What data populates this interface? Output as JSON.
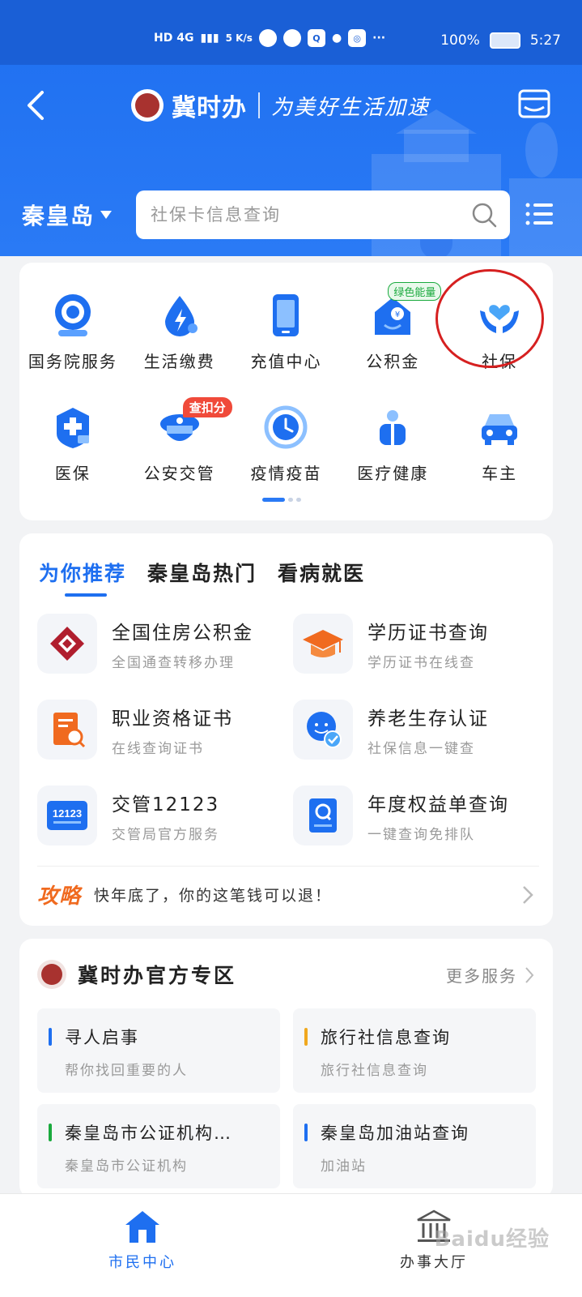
{
  "status_bar": {
    "network": "HD 4G",
    "speed": "5 K/s",
    "more": "···",
    "battery": "100%",
    "time": "5:27"
  },
  "header": {
    "app_name": "冀时办",
    "slogan": "为美好生活加速"
  },
  "search": {
    "city": "秦皇岛",
    "placeholder": "社保卡信息查询"
  },
  "services": {
    "row1": [
      {
        "label": "国务院服务",
        "icon": "state-council-icon"
      },
      {
        "label": "生活缴费",
        "icon": "utility-payment-icon"
      },
      {
        "label": "充值中心",
        "icon": "recharge-icon"
      },
      {
        "label": "公积金",
        "icon": "housing-fund-icon",
        "badge": "绿色能量"
      },
      {
        "label": "社保",
        "icon": "social-security-icon"
      }
    ],
    "row2": [
      {
        "label": "医保",
        "icon": "medical-insurance-icon"
      },
      {
        "label": "公安交管",
        "icon": "traffic-police-icon",
        "badge": "查扣分"
      },
      {
        "label": "疫情疫苗",
        "icon": "vaccine-icon"
      },
      {
        "label": "医疗健康",
        "icon": "health-icon"
      },
      {
        "label": "车主",
        "icon": "car-icon"
      }
    ]
  },
  "recommend": {
    "tabs": [
      "为你推荐",
      "秦皇岛热门",
      "看病就医"
    ],
    "items": [
      {
        "title": "全国住房公积金",
        "sub": "全国通查转移办理"
      },
      {
        "title": "学历证书查询",
        "sub": "学历证书在线查"
      },
      {
        "title": "职业资格证书",
        "sub": "在线查询证书"
      },
      {
        "title": "养老生存认证",
        "sub": "社保信息一键查"
      },
      {
        "title": "交管12123",
        "sub": "交管局官方服务"
      },
      {
        "title": "年度权益单查询",
        "sub": "一键查询免排队"
      }
    ],
    "tip_tag": "攻略",
    "tip_text": "快年底了，你的这笔钱可以退！"
  },
  "official_zone": {
    "title": "冀时办官方专区",
    "more": "更多服务",
    "items": [
      {
        "title": "寻人启事",
        "sub": "帮你找回重要的人",
        "color": "#1e6ff0"
      },
      {
        "title": "旅行社信息查询",
        "sub": "旅行社信息查询",
        "color": "#f0a81e"
      },
      {
        "title": "秦皇岛市公证机构…",
        "sub": "秦皇岛市公证机构",
        "color": "#1aaa3e"
      },
      {
        "title": "秦皇岛加油站查询",
        "sub": "加油站",
        "color": "#1e6ff0"
      }
    ]
  },
  "bottom_nav": {
    "citizen": "市民中心",
    "hall": "办事大厅"
  },
  "watermark": "Baidu经验",
  "colors": {
    "brand_blue": "#1e6ff0",
    "highlight_red": "#d62020",
    "tip_orange": "#f06a1f"
  }
}
